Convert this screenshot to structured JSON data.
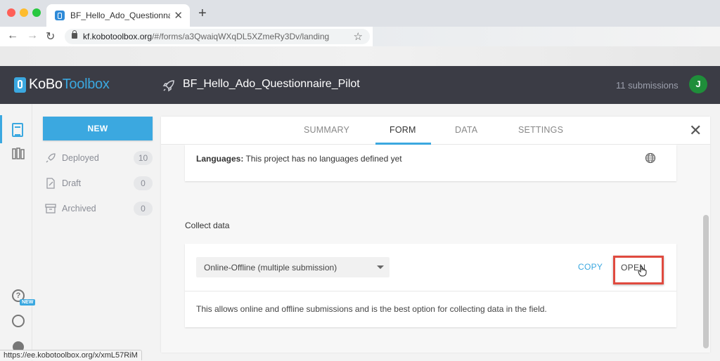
{
  "browser": {
    "tab_title": "BF_Hello_Ado_Questionnaire_Pi",
    "url_domain": "kf.kobotoolbox.org",
    "url_path": "/#/forms/a3QwaiqWXqDL5XZmeRy3Dv/landing",
    "status_url": "https://ee.kobotoolbox.org/x/xmL57RiM"
  },
  "header": {
    "logo_bold": "KoBo",
    "logo_thin": "Toolbox",
    "project_title": "BF_Hello_Ado_Questionnaire_Pilot",
    "submissions": "11 submissions",
    "avatar_initial": "J"
  },
  "iconbar": {
    "new_badge": "NEW"
  },
  "sidebar": {
    "new_label": "NEW",
    "items": [
      {
        "label": "Deployed",
        "count": "10",
        "icon": "rocket-icon"
      },
      {
        "label": "Draft",
        "count": "0",
        "icon": "draft-icon"
      },
      {
        "label": "Archived",
        "count": "0",
        "icon": "archive-icon"
      }
    ]
  },
  "tabs": [
    {
      "label": "SUMMARY",
      "active": false
    },
    {
      "label": "FORM",
      "active": true
    },
    {
      "label": "DATA",
      "active": false
    },
    {
      "label": "SETTINGS",
      "active": false
    }
  ],
  "languages": {
    "label": "Languages:",
    "text": "This project has no languages defined yet"
  },
  "collect": {
    "heading": "Collect data",
    "selected_option": "Online-Offline (multiple submission)",
    "copy_label": "COPY",
    "open_label": "OPEN",
    "description": "This allows online and offline submissions and is the best option for collecting data in the field."
  },
  "colors": {
    "accent": "#3ba8e0",
    "header_bg": "#3b3c45",
    "highlight": "#e04a3f",
    "avatar_bg": "#1f8e3a"
  }
}
